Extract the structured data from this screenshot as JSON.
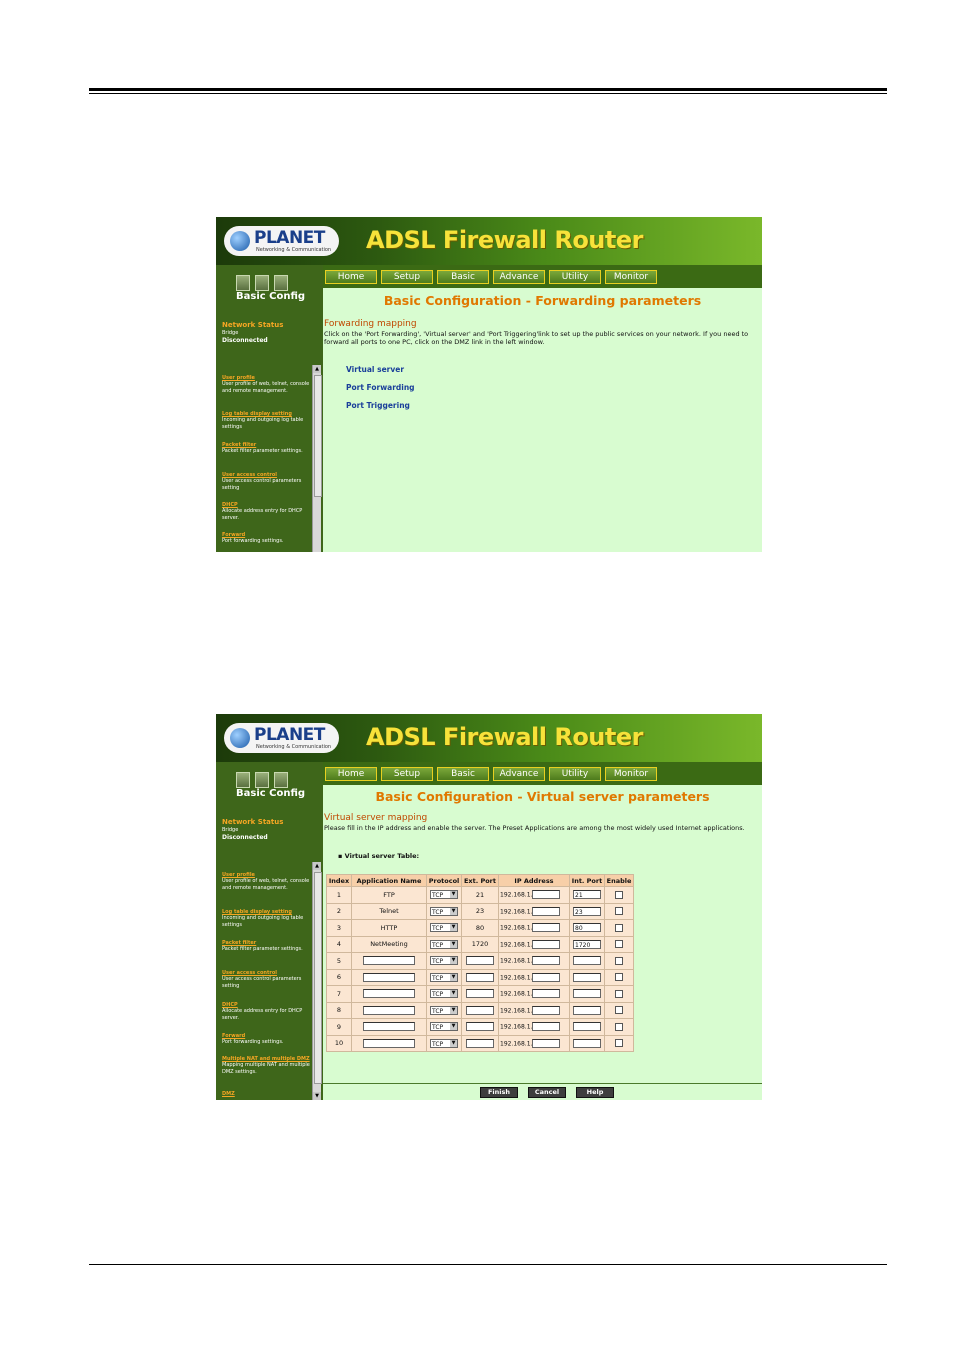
{
  "screens": [
    {
      "logo": {
        "brand": "PLANET",
        "tagline": "Networking & Communication"
      },
      "product_title": "ADSL  Firewall Router",
      "nav": [
        "Home",
        "Setup",
        "Basic",
        "Advance",
        "Utility",
        "Monitor"
      ],
      "sidebar": {
        "title": "Basic Config",
        "network_status": {
          "label": "Network Status",
          "mode": "Bridge",
          "state": "Disconnected"
        },
        "items": [
          {
            "link": "User profile",
            "desc": "User profile of web, telnet, console and remote management."
          },
          {
            "link": "Log table display setting",
            "desc": "Incoming and outgoing log table settings"
          },
          {
            "link": "Packet filter",
            "desc": "Packet filter parameter settings."
          },
          {
            "link": "User access control",
            "desc": "User access control parameters setting"
          },
          {
            "link": "DHCP",
            "desc": "Allocate address entry for DHCP server."
          },
          {
            "link": "Forward",
            "desc": "Port forwarding settings."
          }
        ]
      },
      "page_title": "Basic Configuration - Forwarding parameters",
      "section_title": "Forwarding mapping",
      "section_text": "Click on the 'Port Forwarding', 'Virtual server' and 'Port Triggering'link to set up the public services on your network. If you need to forward all ports to one PC, click on the DMZ link in the left window.",
      "links": [
        "Virtual server",
        "Port Forwarding",
        "Port Triggering"
      ]
    },
    {
      "logo": {
        "brand": "PLANET",
        "tagline": "Networking & Communication"
      },
      "product_title": "ADSL  Firewall Router",
      "nav": [
        "Home",
        "Setup",
        "Basic",
        "Advance",
        "Utility",
        "Monitor"
      ],
      "sidebar": {
        "title": "Basic Config",
        "network_status": {
          "label": "Network Status",
          "mode": "Bridge",
          "state": "Disconnected"
        },
        "items": [
          {
            "link": "User profile",
            "desc": "User profile of web, telnet, console and remote management."
          },
          {
            "link": "Log table display setting",
            "desc": "Incoming and outgoing log table settings"
          },
          {
            "link": "Packet filter",
            "desc": "Packet filter parameter settings."
          },
          {
            "link": "User access control",
            "desc": "User access control parameters setting"
          },
          {
            "link": "DHCP",
            "desc": "Allocate address entry for DHCP server."
          },
          {
            "link": "Forward",
            "desc": "Port forwarding settings."
          },
          {
            "link": "Multiple NAT and multiple DMZ",
            "desc": "Mapping multiple NAT and multiple DMZ settings."
          },
          {
            "link": "DMZ",
            "desc": ""
          }
        ]
      },
      "page_title": "Basic Configuration - Virtual server parameters",
      "section_title": "Virtual server mapping",
      "section_text": "Please fill in the IP address and enable the server. The Preset Applications are among the most widely used Internet applications.",
      "table_caption": "Virtual server Table:",
      "table_headers": [
        "Index",
        "Application Name",
        "Protocol",
        "Ext. Port",
        "IP Address",
        "Int. Port",
        "Enable"
      ],
      "ip_prefix": "192.168.1.",
      "rows": [
        {
          "index": "1",
          "app": "FTP",
          "protocol": "TCP",
          "ext": "21",
          "int": "21",
          "preset": true
        },
        {
          "index": "2",
          "app": "Telnet",
          "protocol": "TCP",
          "ext": "23",
          "int": "23",
          "preset": true
        },
        {
          "index": "3",
          "app": "HTTP",
          "protocol": "TCP",
          "ext": "80",
          "int": "80",
          "preset": true
        },
        {
          "index": "4",
          "app": "NetMeeting",
          "protocol": "TCP",
          "ext": "1720",
          "int": "1720",
          "preset": true
        },
        {
          "index": "5",
          "app": "",
          "protocol": "TCP",
          "ext": "",
          "int": "",
          "preset": false
        },
        {
          "index": "6",
          "app": "",
          "protocol": "TCP",
          "ext": "",
          "int": "",
          "preset": false
        },
        {
          "index": "7",
          "app": "",
          "protocol": "TCP",
          "ext": "",
          "int": "",
          "preset": false
        },
        {
          "index": "8",
          "app": "",
          "protocol": "TCP",
          "ext": "",
          "int": "",
          "preset": false
        },
        {
          "index": "9",
          "app": "",
          "protocol": "TCP",
          "ext": "",
          "int": "",
          "preset": false
        },
        {
          "index": "10",
          "app": "",
          "protocol": "TCP",
          "ext": "",
          "int": "",
          "preset": false
        }
      ],
      "buttons": [
        "Finish",
        "Cancel",
        "Help"
      ]
    }
  ]
}
